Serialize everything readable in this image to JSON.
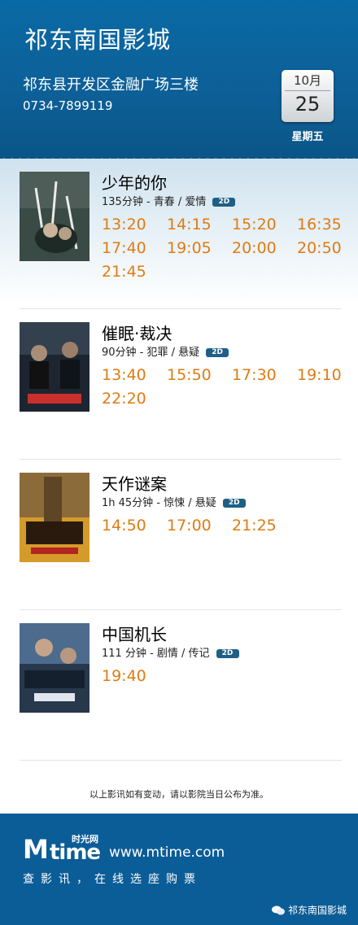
{
  "header": {
    "cinema_name": "祁东南国影城",
    "address": "祁东县开发区金融广场三楼",
    "phone": "0734-7899119",
    "date": {
      "month": "10月",
      "day": "25",
      "weekday": "星期五"
    }
  },
  "movies": [
    {
      "title": "少年的你",
      "meta": "135分钟 - 青春 / 爱情",
      "format": "2D",
      "times": [
        "13:20",
        "14:15",
        "15:20",
        "16:35",
        "17:40",
        "19:05",
        "20:00",
        "20:50",
        "21:45"
      ]
    },
    {
      "title": "催眠·裁决",
      "meta": "90分钟 - 犯罪 / 悬疑",
      "format": "2D",
      "times": [
        "13:40",
        "15:50",
        "17:30",
        "19:10",
        "22:20"
      ]
    },
    {
      "title": "天作谜案",
      "meta": "1h 45分钟 - 惊悚 / 悬疑",
      "format": "2D",
      "times": [
        "14:50",
        "17:00",
        "21:25"
      ]
    },
    {
      "title": "中国机长",
      "meta": "111 分钟 - 剧情 / 传记",
      "format": "2D",
      "times": [
        "19:40"
      ]
    }
  ],
  "notice": "以上影讯如有变动，请以影院当日公布为准。",
  "footer": {
    "logo_m": "M",
    "logo_time": "time",
    "logo_cn": "时光网",
    "url": "www.mtime.com",
    "slogan": "查影讯，在线选座购票",
    "wechat_account": "祁东南国影城"
  },
  "colors": {
    "header_blue": "#0b5d97",
    "showtime_orange": "#e07b12",
    "badge_blue": "#1f5f86"
  }
}
